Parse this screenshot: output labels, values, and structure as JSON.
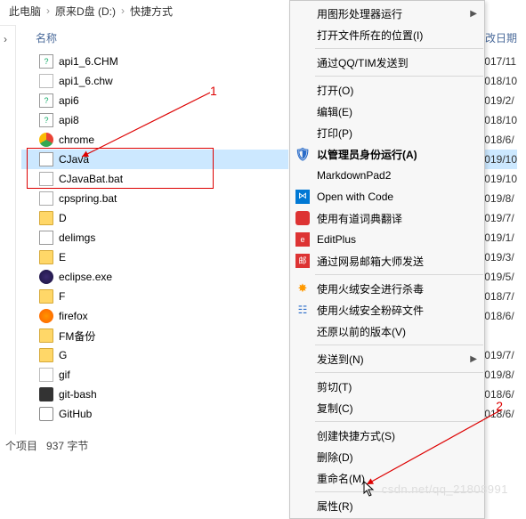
{
  "breadcrumb": {
    "a": "此电脑",
    "b": "原来D盘 (D:)",
    "c": "快捷方式"
  },
  "columns": {
    "name": "名称",
    "date": "改日期"
  },
  "files": [
    {
      "name": "api1_6.CHM",
      "icon": "chm",
      "date": "017/11"
    },
    {
      "name": "api1_6.chw",
      "icon": "file",
      "date": "018/10"
    },
    {
      "name": "api6",
      "icon": "chm",
      "date": "019/2/"
    },
    {
      "name": "api8",
      "icon": "chm",
      "date": "018/10"
    },
    {
      "name": "chrome",
      "icon": "chrome",
      "date": "018/6/"
    },
    {
      "name": "CJava",
      "icon": "exe",
      "date": "019/10",
      "selected": true
    },
    {
      "name": "CJavaBat.bat",
      "icon": "bat",
      "date": "019/10"
    },
    {
      "name": "cpspring.bat",
      "icon": "bat",
      "date": "019/8/"
    },
    {
      "name": "D",
      "icon": "folder",
      "date": "019/7/"
    },
    {
      "name": "delimgs",
      "icon": "exe",
      "date": "019/1/"
    },
    {
      "name": "E",
      "icon": "folder",
      "date": "019/3/"
    },
    {
      "name": "eclipse.exe",
      "icon": "eclipse",
      "date": "019/5/"
    },
    {
      "name": "F",
      "icon": "folder",
      "date": "018/7/"
    },
    {
      "name": "firefox",
      "icon": "firefox",
      "date": "018/6/"
    },
    {
      "name": "FM备份",
      "icon": "folder",
      "date": ""
    },
    {
      "name": "G",
      "icon": "folder",
      "date": "019/7/"
    },
    {
      "name": "gif",
      "icon": "gif",
      "date": "019/8/"
    },
    {
      "name": "git-bash",
      "icon": "git",
      "date": "018/6/"
    },
    {
      "name": "GitHub",
      "icon": "github",
      "date": "018/6/"
    }
  ],
  "status": {
    "items": "个项目",
    "size": "937 字节"
  },
  "annotations": {
    "one": "1",
    "two": "2"
  },
  "menu": {
    "run_gpu": "用图形处理器运行",
    "open_loc": "打开文件所在的位置(I)",
    "send_qq": "通过QQ/TIM发送到",
    "open": "打开(O)",
    "edit": "编辑(E)",
    "print": "打印(P)",
    "run_admin": "以管理员身份运行(A)",
    "markdownpad": "MarkdownPad2",
    "open_code": "Open with Code",
    "youdao": "使用有道词典翻译",
    "editplus": "EditPlus",
    "netease": "通过网易邮箱大师发送",
    "huorong_scan": "使用火绒安全进行杀毒",
    "huorong_shred": "使用火绒安全粉碎文件",
    "restore_ver": "还原以前的版本(V)",
    "send_to": "发送到(N)",
    "cut": "剪切(T)",
    "copy": "复制(C)",
    "shortcut": "创建快捷方式(S)",
    "delete": "删除(D)",
    "rename": "重命名(M)",
    "properties": "属性(R)"
  },
  "watermark": "csdn.net/qq_21808991"
}
